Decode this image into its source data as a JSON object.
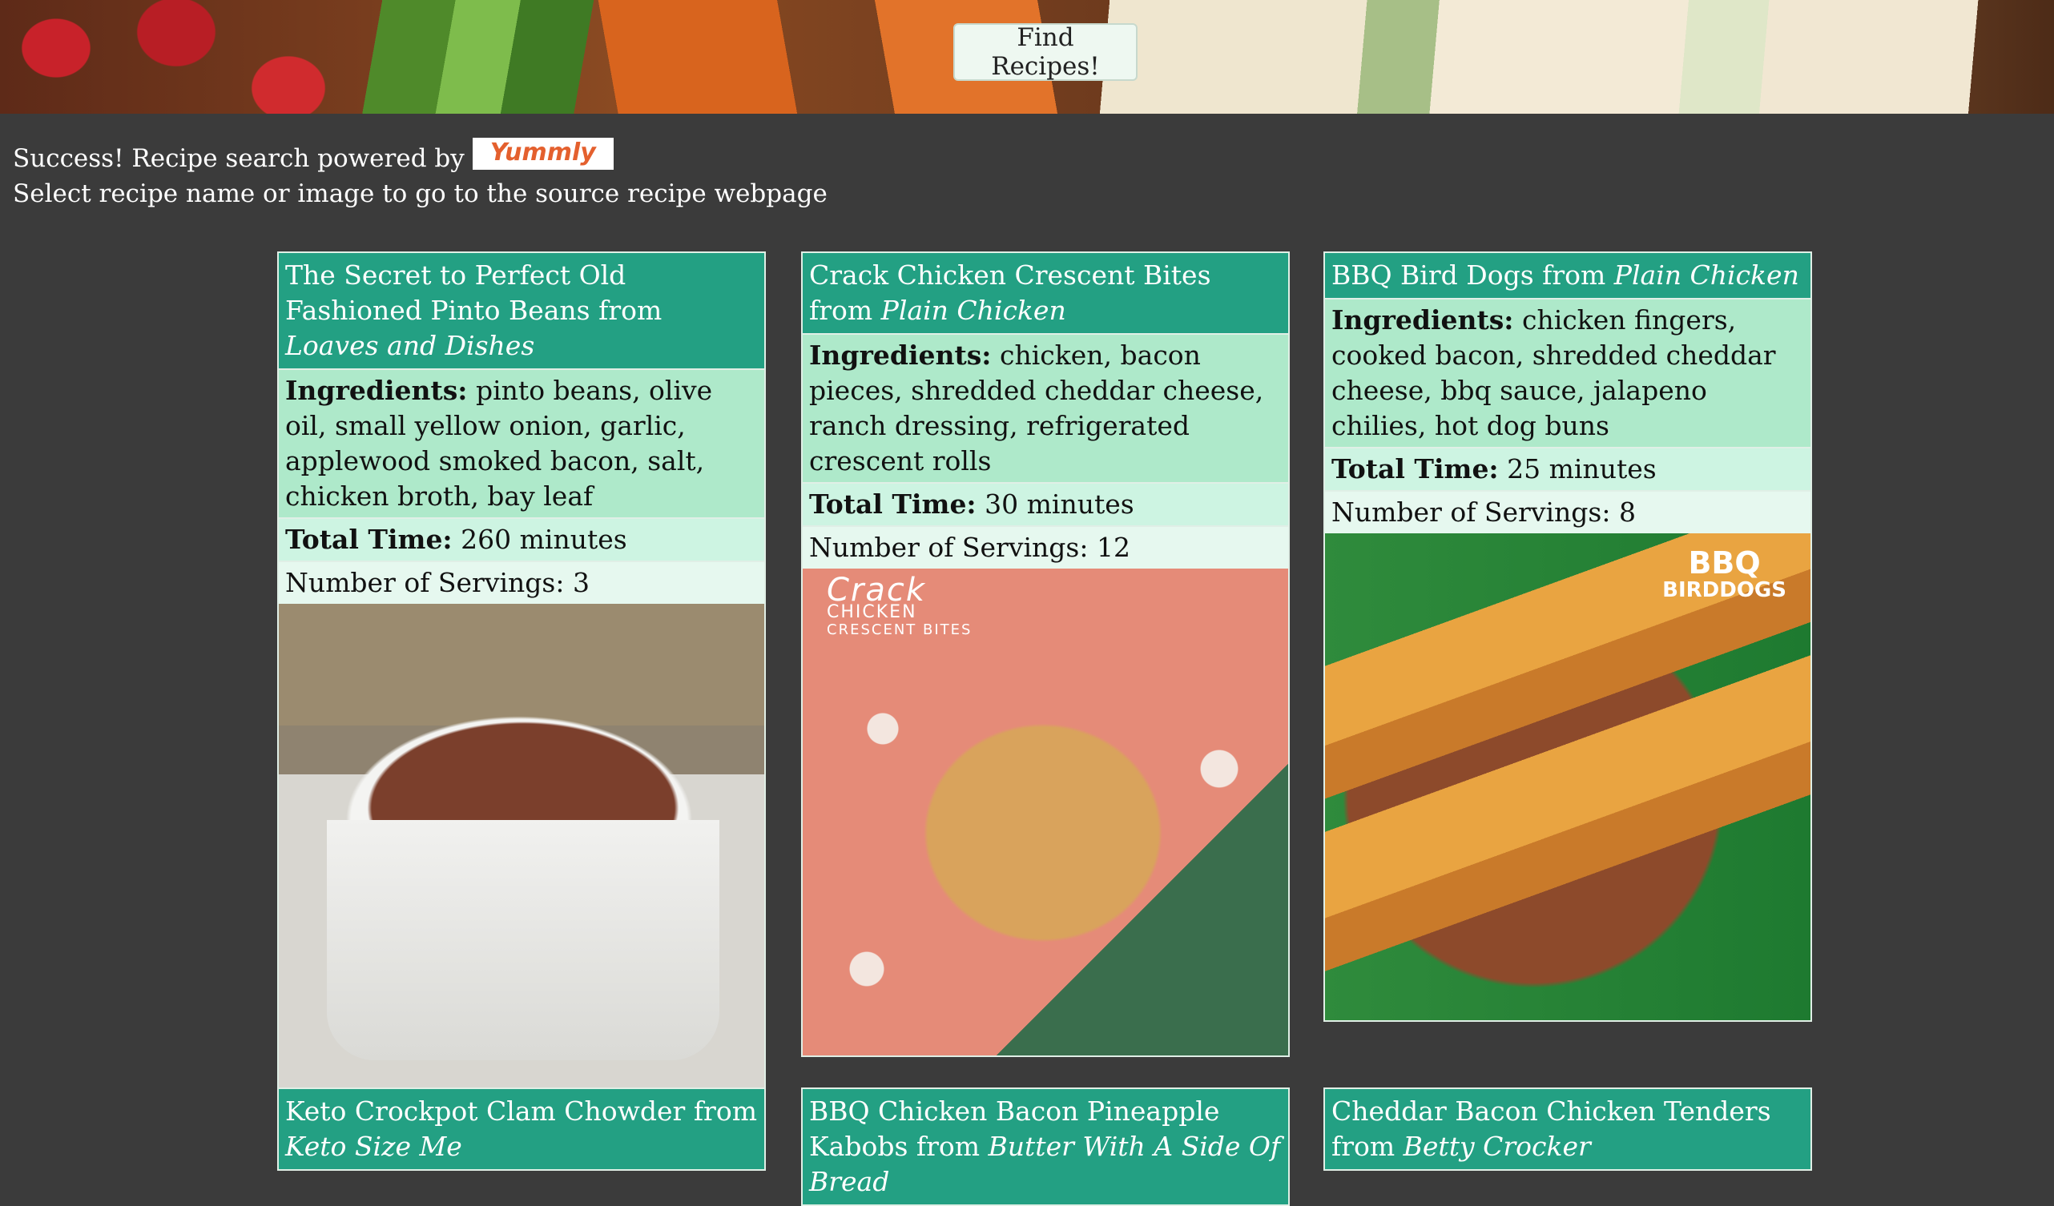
{
  "header": {
    "find_button": "Find Recipes!"
  },
  "status": {
    "success_text": "Success! Recipe search powered by",
    "logo_text": "Yummly",
    "instruction": "Select recipe name or image to go to the source recipe webpage"
  },
  "labels": {
    "ingredients": "Ingredients:",
    "total_time": "Total Time:",
    "servings": "Number of Servings:",
    "from": "from"
  },
  "recipes": [
    {
      "name": "The Secret to Perfect Old Fashioned Pinto Beans",
      "source": "Loaves and Dishes",
      "ingredients": "pinto beans, olive oil, small yellow onion, garlic, applewood smoked bacon, salt, chicken broth, bay leaf",
      "total_time": "260 minutes",
      "servings": "3"
    },
    {
      "name": "Crack Chicken Crescent Bites",
      "source": "Plain Chicken",
      "ingredients": "chicken, bacon pieces, shredded cheddar cheese, ranch dressing, refrigerated crescent rolls",
      "total_time": "30 minutes",
      "servings": "12",
      "image_text": [
        "Crack",
        "CHICKEN",
        "CRESCENT BITES"
      ]
    },
    {
      "name": "BBQ Bird Dogs",
      "source": "Plain Chicken",
      "ingredients": "chicken fingers, cooked bacon, shredded cheddar cheese, bbq sauce, jalapeno chilies, hot dog buns",
      "total_time": "25 minutes",
      "servings": "8",
      "image_text": [
        "BBQ",
        "BIRDDOGS"
      ]
    },
    {
      "name": "Keto Crockpot Clam Chowder",
      "source": "Keto Size Me"
    },
    {
      "name": "BBQ Chicken Bacon Pineapple Kabobs",
      "source": "Butter With A Side Of Bread"
    },
    {
      "name": "Cheddar Bacon Chicken Tenders",
      "source": "Betty Crocker"
    }
  ]
}
